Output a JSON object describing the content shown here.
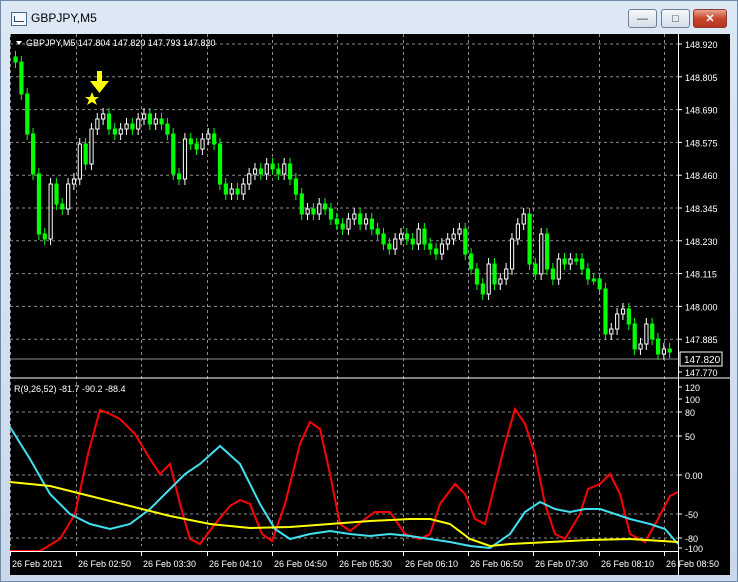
{
  "window": {
    "title": "GBPJPY,M5",
    "minimize_glyph": "—",
    "maximize_glyph": "□",
    "close_glyph": "✕"
  },
  "price_chart": {
    "header": "GBPJPY,M5  147.804 147.820 147.793 147.820",
    "symbol": "GBPJPY,M5",
    "open": 147.804,
    "high": 147.82,
    "low": 147.793,
    "close": 147.82,
    "current_price_label": "147.820",
    "y_ticks": [
      "148.920",
      "148.805",
      "148.690",
      "148.575",
      "148.460",
      "148.345",
      "148.230",
      "148.115",
      "148.000",
      "147.885",
      "147.770"
    ],
    "colors": {
      "up": "#ffffff",
      "down": "#00ff00",
      "grid": "#8c8c8c",
      "text": "#ffffff",
      "arrow": "#ffff00"
    },
    "arrow_icon": "down-arrow-icon",
    "star_icon": "star-icon"
  },
  "indicator": {
    "header": "R(9,26,52) -81.7 -90.2 -88.4",
    "params": "R(9,26,52)",
    "values": [
      -81.7,
      -90.2,
      -88.4
    ],
    "y_ticks": [
      "120",
      "100",
      "80",
      "50",
      "0.00",
      "-50",
      "-80",
      "-100"
    ],
    "series_colors": [
      "#ff0000",
      "#40e0f0",
      "#ffff00"
    ]
  },
  "x_axis": {
    "labels": [
      "26 Feb 2021",
      "26 Feb 02:50",
      "26 Feb 03:30",
      "26 Feb 04:10",
      "26 Feb 04:50",
      "26 Feb 05:30",
      "26 Feb 06:10",
      "26 Feb 06:50",
      "26 Feb 07:30",
      "26 Feb 08:10",
      "26 Feb 08:50"
    ]
  }
}
